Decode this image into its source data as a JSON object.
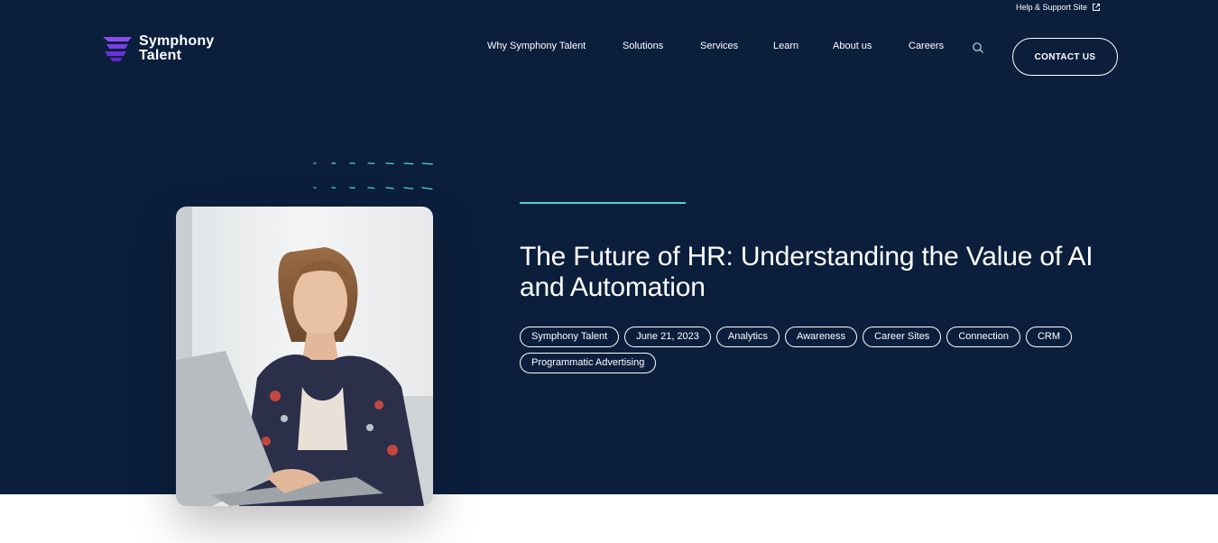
{
  "topbar": {
    "help_link": "Help & Support Site",
    "external_icon": "external-link-icon"
  },
  "brand": {
    "line1": "Symphony",
    "line2": "Talent",
    "icon": "symphony-logo-icon",
    "accent_color": "#7b3fe4"
  },
  "nav": {
    "items": [
      {
        "label": "Why Symphony Talent"
      },
      {
        "label": "Solutions"
      },
      {
        "label": "Services"
      },
      {
        "label": "Learn"
      },
      {
        "label": "About us"
      },
      {
        "label": "Careers"
      }
    ],
    "search_icon": "search-icon",
    "contact_label": "CONTACT US"
  },
  "hero": {
    "title": "The Future of HR: Understanding the Value of AI and Automation",
    "background_color": "#0b1f3d",
    "accent_color": "#57d0d2",
    "tags": [
      "Symphony Talent",
      "June 21, 2023",
      "Analytics",
      "Awareness",
      "Career Sites",
      "Connection",
      "CRM",
      "Programmatic Advertising"
    ]
  }
}
